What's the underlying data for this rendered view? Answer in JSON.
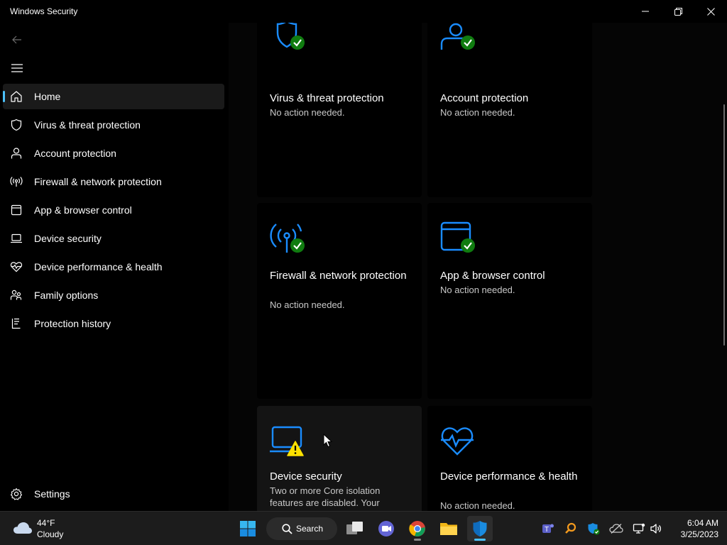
{
  "window": {
    "title": "Windows Security",
    "minimize": "minimize",
    "restore": "restore",
    "close": "close"
  },
  "sidebar": {
    "items": [
      {
        "label": "Home",
        "icon": "home-icon",
        "active": true
      },
      {
        "label": "Virus & threat protection",
        "icon": "shield-icon"
      },
      {
        "label": "Account protection",
        "icon": "person-icon"
      },
      {
        "label": "Firewall & network protection",
        "icon": "antenna-icon"
      },
      {
        "label": "App & browser control",
        "icon": "app-window-icon"
      },
      {
        "label": "Device security",
        "icon": "laptop-icon"
      },
      {
        "label": "Device performance & health",
        "icon": "heart-pulse-icon"
      },
      {
        "label": "Family options",
        "icon": "family-icon"
      },
      {
        "label": "Protection history",
        "icon": "history-icon"
      }
    ],
    "settings_label": "Settings"
  },
  "cards": [
    {
      "title": "Virus & threat protection",
      "status": "No action needed.",
      "state": "ok"
    },
    {
      "title": "Account protection",
      "status": "No action needed.",
      "state": "ok"
    },
    {
      "title": "Firewall & network protection",
      "status": "No action needed.",
      "state": "ok"
    },
    {
      "title": "App & browser control",
      "status": "No action needed.",
      "state": "ok"
    },
    {
      "title": "Device security",
      "status": "Two or more Core isolation features are disabled.  Your",
      "state": "warning"
    },
    {
      "title": "Device performance & health",
      "status": "No action needed.",
      "state": "ok"
    }
  ],
  "taskbar": {
    "weather": {
      "temp": "44°F",
      "condition": "Cloudy"
    },
    "search_label": "Search",
    "apps": [
      "start-icon",
      "search-icon",
      "task-view-icon",
      "chat-icon",
      "chrome-icon",
      "file-explorer-icon",
      "windows-security-icon"
    ],
    "clock": {
      "time": "6:04 AM",
      "date": "3/25/2023"
    }
  },
  "colors": {
    "accent": "#4cc2ff",
    "icon_blue": "#1a8cff",
    "ok_green": "#107c10",
    "warning_yellow": "#fce100"
  }
}
